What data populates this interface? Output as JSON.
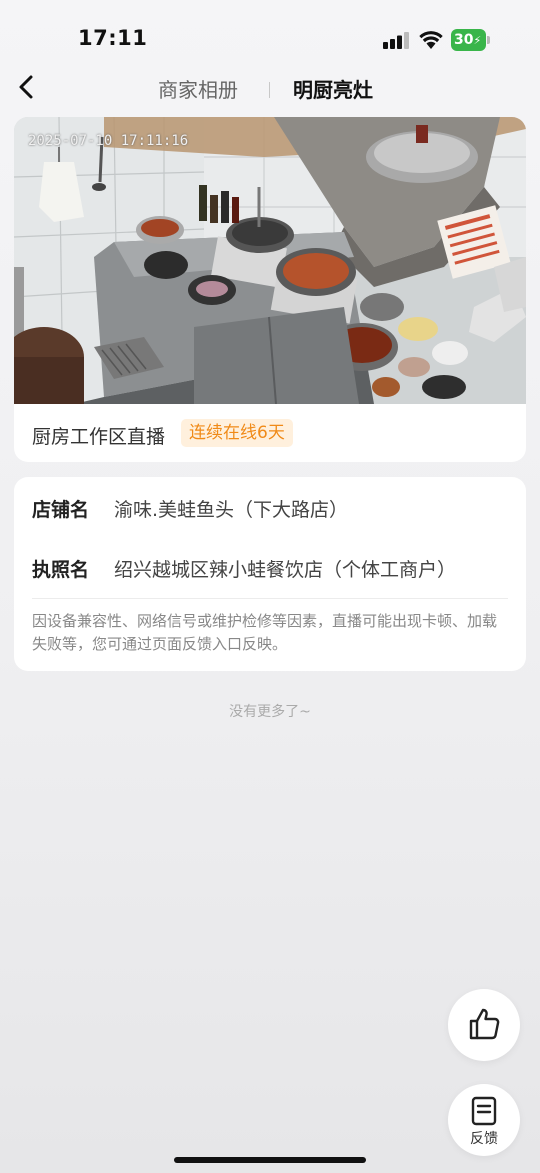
{
  "status_bar": {
    "time": "17:11",
    "battery_level": "30",
    "battery_color": "#39b54a",
    "icons": [
      "signal-icon",
      "wifi-icon",
      "battery-charging-icon"
    ]
  },
  "nav": {
    "back_icon": "chevron-left-icon",
    "tabs": [
      {
        "label": "商家相册",
        "active": false
      },
      {
        "label": "明厨亮灶",
        "active": true
      }
    ]
  },
  "live": {
    "timestamp": "2025-07-10 17:11:16",
    "caption": "厨房工作区直播",
    "badge": "连续在线6天",
    "badge_color": "#f08a18"
  },
  "store_info": {
    "rows": [
      {
        "label": "店铺名",
        "value": "渝味.美蛙鱼头（下大路店）"
      },
      {
        "label": "执照名",
        "value": "绍兴越城区辣小蛙餐饮店（个体工商户）"
      }
    ],
    "note": "因设备兼容性、网络信号或维护检修等因素，直播可能出现卡顿、加载失败等，您可通过页面反馈入口反映。"
  },
  "footer": {
    "no_more": "没有更多了~"
  },
  "floating": {
    "like_icon": "thumbs-up-icon",
    "feedback_icon": "feedback-icon",
    "feedback_label": "反馈"
  }
}
